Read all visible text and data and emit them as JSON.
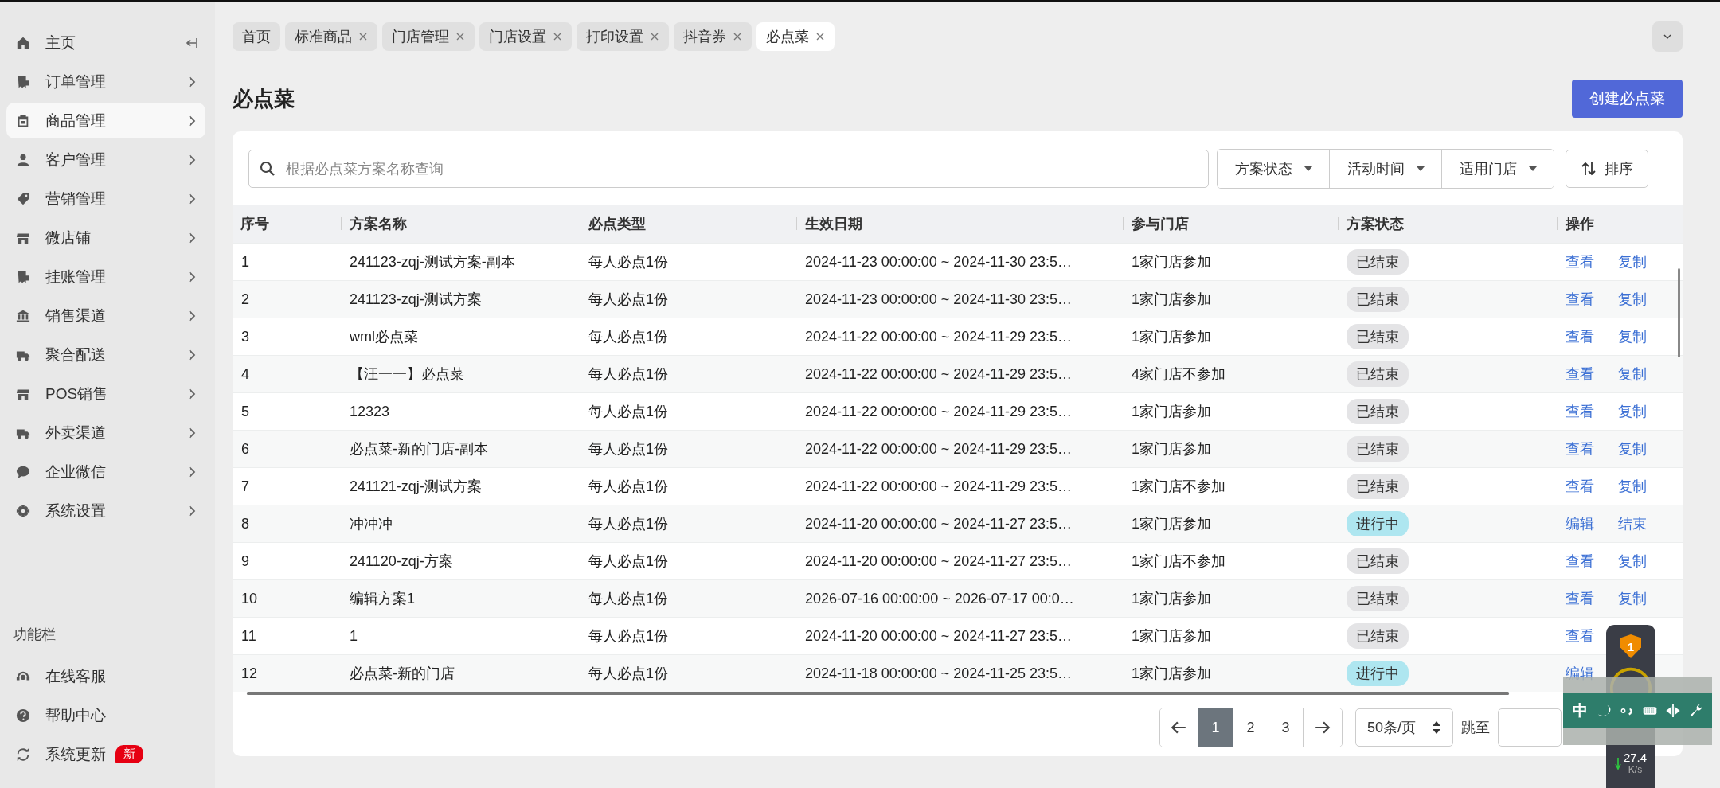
{
  "sidebar": {
    "items": [
      {
        "label": "主页",
        "kind": "home",
        "selected": false
      },
      {
        "label": "订单管理",
        "kind": "receipt",
        "selected": false
      },
      {
        "label": "商品管理",
        "kind": "box",
        "selected": true
      },
      {
        "label": "客户管理",
        "kind": "user",
        "selected": false
      },
      {
        "label": "营销管理",
        "kind": "tag",
        "selected": false
      },
      {
        "label": "微店铺",
        "kind": "store",
        "selected": false
      },
      {
        "label": "挂账管理",
        "kind": "receipt",
        "selected": false
      },
      {
        "label": "销售渠道",
        "kind": "bank",
        "selected": false
      },
      {
        "label": "聚合配送",
        "kind": "truck",
        "selected": false
      },
      {
        "label": "POS销售",
        "kind": "store",
        "selected": false
      },
      {
        "label": "外卖渠道",
        "kind": "truck",
        "selected": false
      },
      {
        "label": "企业微信",
        "kind": "chat",
        "selected": false
      },
      {
        "label": "系统设置",
        "kind": "gear",
        "selected": false
      }
    ],
    "footer_title": "功能栏",
    "footer_items": [
      {
        "label": "在线客服",
        "kind": "headset"
      },
      {
        "label": "帮助中心",
        "kind": "help"
      },
      {
        "label": "系统更新",
        "kind": "refresh",
        "badge": "新"
      }
    ]
  },
  "tabs": [
    {
      "label": "首页",
      "selected": false,
      "closable": false
    },
    {
      "label": "标准商品",
      "selected": false,
      "closable": true
    },
    {
      "label": "门店管理",
      "selected": false,
      "closable": true
    },
    {
      "label": "门店设置",
      "selected": false,
      "closable": true
    },
    {
      "label": "打印设置",
      "selected": false,
      "closable": true
    },
    {
      "label": "抖音券",
      "selected": false,
      "closable": true
    },
    {
      "label": "必点菜",
      "selected": true,
      "closable": true
    }
  ],
  "page_title": "必点菜",
  "create_button": "创建必点菜",
  "search": {
    "placeholder": "根据必点菜方案名称查询"
  },
  "filters": [
    "方案状态",
    "活动时间",
    "适用门店"
  ],
  "sort_button": "排序",
  "table": {
    "columns": [
      "序号",
      "方案名称",
      "必点类型",
      "生效日期",
      "参与门店",
      "方案状态",
      "操作"
    ],
    "rows": [
      {
        "no": "1",
        "name": "241123-zqj-测试方案-副本",
        "type": "每人必点1份",
        "date": "2024-11-23 00:00:00 ~ 2024-11-30 23:5…",
        "stores": "1家门店参加",
        "status": {
          "label": "已结束",
          "color": "#e4e4e6"
        },
        "actions": [
          "查看",
          "复制"
        ]
      },
      {
        "no": "2",
        "name": "241123-zqj-测试方案",
        "type": "每人必点1份",
        "date": "2024-11-23 00:00:00 ~ 2024-11-30 23:5…",
        "stores": "1家门店参加",
        "status": {
          "label": "已结束",
          "color": "#e4e4e6"
        },
        "actions": [
          "查看",
          "复制"
        ]
      },
      {
        "no": "3",
        "name": "wml必点菜",
        "type": "每人必点1份",
        "date": "2024-11-22 00:00:00 ~ 2024-11-29 23:5…",
        "stores": "1家门店参加",
        "status": {
          "label": "已结束",
          "color": "#e4e4e6"
        },
        "actions": [
          "查看",
          "复制"
        ]
      },
      {
        "no": "4",
        "name": "【汪一一】必点菜",
        "type": "每人必点1份",
        "date": "2024-11-22 00:00:00 ~ 2024-11-29 23:5…",
        "stores": "4家门店不参加",
        "status": {
          "label": "已结束",
          "color": "#e4e4e6"
        },
        "actions": [
          "查看",
          "复制"
        ]
      },
      {
        "no": "5",
        "name": "12323",
        "type": "每人必点1份",
        "date": "2024-11-22 00:00:00 ~ 2024-11-29 23:5…",
        "stores": "1家门店参加",
        "status": {
          "label": "已结束",
          "color": "#e4e4e6"
        },
        "actions": [
          "查看",
          "复制"
        ]
      },
      {
        "no": "6",
        "name": "必点菜-新的门店-副本",
        "type": "每人必点1份",
        "date": "2024-11-22 00:00:00 ~ 2024-11-29 23:5…",
        "stores": "1家门店参加",
        "status": {
          "label": "已结束",
          "color": "#e4e4e6"
        },
        "actions": [
          "查看",
          "复制"
        ]
      },
      {
        "no": "7",
        "name": "241121-zqj-测试方案",
        "type": "每人必点1份",
        "date": "2024-11-22 00:00:00 ~ 2024-11-29 23:5…",
        "stores": "1家门店不参加",
        "status": {
          "label": "已结束",
          "color": "#e4e4e6"
        },
        "actions": [
          "查看",
          "复制"
        ]
      },
      {
        "no": "8",
        "name": "冲冲冲",
        "type": "每人必点1份",
        "date": "2024-11-20 00:00:00 ~ 2024-11-27 23:5…",
        "stores": "1家门店参加",
        "status": {
          "label": "进行中",
          "color": "#aee6f0"
        },
        "actions": [
          "编辑",
          "结束"
        ]
      },
      {
        "no": "9",
        "name": "241120-zqj-方案",
        "type": "每人必点1份",
        "date": "2024-11-20 00:00:00 ~ 2024-11-27 23:5…",
        "stores": "1家门店不参加",
        "status": {
          "label": "已结束",
          "color": "#e4e4e6"
        },
        "actions": [
          "查看",
          "复制"
        ]
      },
      {
        "no": "10",
        "name": "编辑方案1",
        "type": "每人必点1份",
        "date": "2026-07-16 00:00:00 ~ 2026-07-17 00:0…",
        "stores": "1家门店参加",
        "status": {
          "label": "已结束",
          "color": "#e4e4e6"
        },
        "actions": [
          "查看",
          "复制"
        ]
      },
      {
        "no": "11",
        "name": "1",
        "type": "每人必点1份",
        "date": "2024-11-20 00:00:00 ~ 2024-11-27 23:5…",
        "stores": "1家门店参加",
        "status": {
          "label": "已结束",
          "color": "#e4e4e6"
        },
        "actions": [
          "查看"
        ]
      },
      {
        "no": "12",
        "name": "必点菜-新的门店",
        "type": "每人必点1份",
        "date": "2024-11-18 00:00:00 ~ 2024-11-25 23:5…",
        "stores": "1家门店参加",
        "status": {
          "label": "进行中",
          "color": "#aee6f0"
        },
        "actions": [
          "编辑"
        ]
      }
    ]
  },
  "pagination": {
    "pages": [
      {
        "label": "1",
        "selected": true
      },
      {
        "label": "2",
        "selected": false
      },
      {
        "label": "3",
        "selected": false
      }
    ],
    "page_size": "50条/页",
    "jump_label": "跳至"
  },
  "monitor": {
    "badge": "1",
    "download": "27.4",
    "unit": "K/s"
  },
  "ime_bar": {
    "label": "中"
  }
}
